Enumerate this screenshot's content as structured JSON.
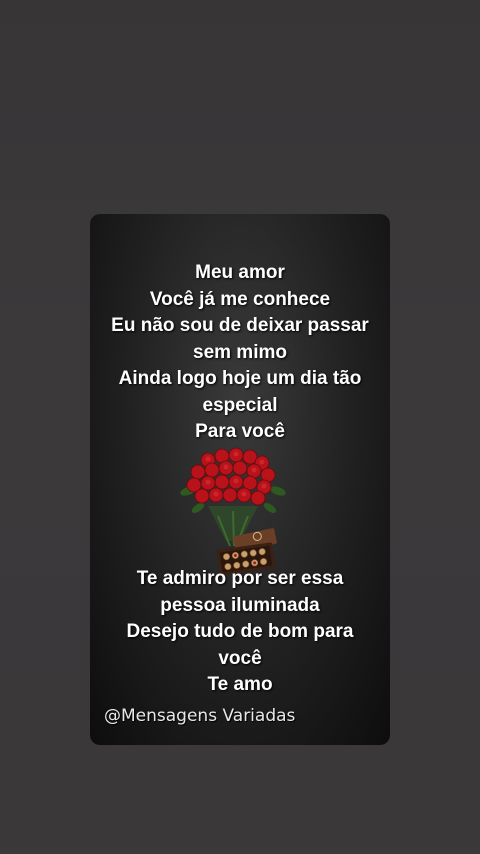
{
  "message": {
    "top_lines": [
      "Meu amor",
      "Você já me conhece",
      "Eu não sou de deixar passar",
      "sem mimo",
      "Ainda logo hoje um dia tão",
      "especial",
      "Para você"
    ],
    "bottom_lines": [
      "Te admiro por ser essa",
      "pessoa iluminada",
      "Desejo tudo de bom para",
      "você",
      "Te amo"
    ]
  },
  "image": {
    "icon": "roses-and-chocolates-icon"
  },
  "watermark": "@Mensagens Variadas",
  "colors": {
    "background": "#3a3839",
    "card": "#1a1a1a",
    "text": "#ffffff",
    "rose": "#c0141a",
    "chocolate_box": "#5a3520"
  }
}
